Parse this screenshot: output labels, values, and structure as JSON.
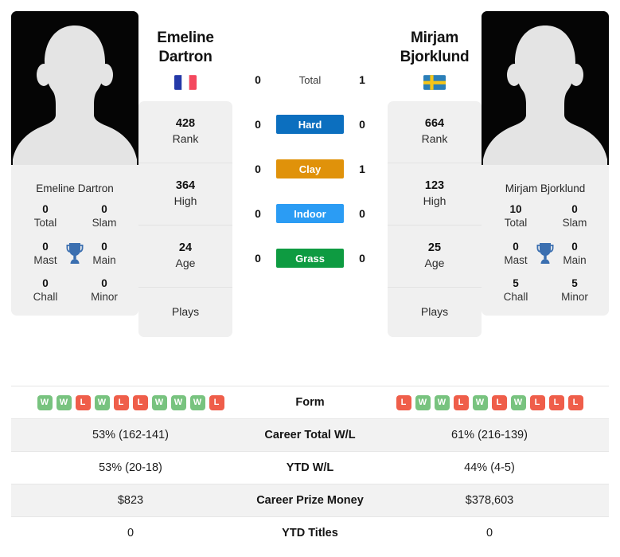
{
  "players": {
    "left": {
      "first_name": "Emeline",
      "last_name": "Dartron",
      "full_name": "Emeline Dartron",
      "flag": "fr-flag-icon",
      "titles": [
        {
          "value": "0",
          "label": "Total"
        },
        {
          "value": "0",
          "label": "Slam"
        },
        {
          "value": "0",
          "label": "Mast"
        },
        {
          "value": "0",
          "label": "Main"
        },
        {
          "value": "0",
          "label": "Chall"
        },
        {
          "value": "0",
          "label": "Minor"
        }
      ],
      "info": [
        {
          "value": "428",
          "label": "Rank"
        },
        {
          "value": "364",
          "label": "High"
        },
        {
          "value": "24",
          "label": "Age"
        }
      ],
      "plays_label": "Plays",
      "surface_wins": {
        "total": "0",
        "hard": "0",
        "clay": "0",
        "indoor": "0",
        "grass": "0"
      },
      "form": [
        "W",
        "W",
        "L",
        "W",
        "L",
        "L",
        "W",
        "W",
        "W",
        "L"
      ],
      "career_total_wl": "53% (162-141)",
      "ytd_wl": "53% (20-18)",
      "career_prize_money": "$823",
      "ytd_titles": "0"
    },
    "right": {
      "first_name": "Mirjam",
      "last_name": "Bjorklund",
      "full_name": "Mirjam Bjorklund",
      "flag": "se-flag-icon",
      "titles": [
        {
          "value": "10",
          "label": "Total"
        },
        {
          "value": "0",
          "label": "Slam"
        },
        {
          "value": "0",
          "label": "Mast"
        },
        {
          "value": "0",
          "label": "Main"
        },
        {
          "value": "5",
          "label": "Chall"
        },
        {
          "value": "5",
          "label": "Minor"
        }
      ],
      "info": [
        {
          "value": "664",
          "label": "Rank"
        },
        {
          "value": "123",
          "label": "High"
        },
        {
          "value": "25",
          "label": "Age"
        }
      ],
      "plays_label": "Plays",
      "surface_wins": {
        "total": "1",
        "hard": "0",
        "clay": "1",
        "indoor": "0",
        "grass": "0"
      },
      "form": [
        "L",
        "W",
        "W",
        "L",
        "W",
        "L",
        "W",
        "L",
        "L",
        "L"
      ],
      "career_total_wl": "61% (216-139)",
      "ytd_wl": "44% (4-5)",
      "career_prize_money": "$378,603",
      "ytd_titles": "0"
    }
  },
  "surfaces": [
    {
      "key": "total",
      "label": "Total",
      "color": "transparent",
      "plain": true
    },
    {
      "key": "hard",
      "label": "Hard",
      "color": "#0C6FBF",
      "plain": false
    },
    {
      "key": "clay",
      "label": "Clay",
      "color": "#E0920A",
      "plain": false
    },
    {
      "key": "indoor",
      "label": "Indoor",
      "color": "#2B9CF4",
      "plain": false
    },
    {
      "key": "grass",
      "label": "Grass",
      "color": "#0E9B41",
      "plain": false
    }
  ],
  "table": {
    "rows": [
      {
        "label": "Form",
        "type": "form",
        "shade": false
      },
      {
        "label": "Career Total W/L",
        "type": "text",
        "key": "career_total_wl",
        "shade": true
      },
      {
        "label": "YTD W/L",
        "type": "text",
        "key": "ytd_wl",
        "shade": false
      },
      {
        "label": "Career Prize Money",
        "type": "text",
        "key": "career_prize_money",
        "shade": true
      },
      {
        "label": "YTD Titles",
        "type": "text",
        "key": "ytd_titles",
        "shade": false
      }
    ]
  },
  "colors": {
    "hard": "#0C6FBF",
    "clay": "#E0920A",
    "indoor": "#2B9CF4",
    "grass": "#0E9B41",
    "win_badge": "#78C37F",
    "loss_badge": "#EF5E4A",
    "trophy": "#3B6FB0",
    "card_bg": "#F0F0F0"
  }
}
